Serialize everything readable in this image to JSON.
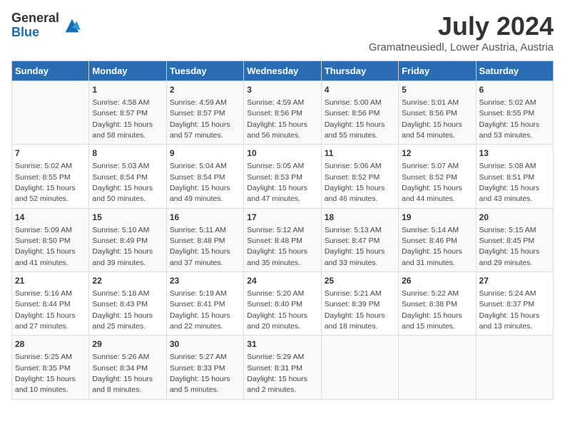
{
  "logo": {
    "general": "General",
    "blue": "Blue"
  },
  "title": "July 2024",
  "subtitle": "Gramatneusiedl, Lower Austria, Austria",
  "weekdays": [
    "Sunday",
    "Monday",
    "Tuesday",
    "Wednesday",
    "Thursday",
    "Friday",
    "Saturday"
  ],
  "weeks": [
    [
      {
        "day": null,
        "info": ""
      },
      {
        "day": "1",
        "info": "Sunrise: 4:58 AM\nSunset: 8:57 PM\nDaylight: 15 hours\nand 58 minutes."
      },
      {
        "day": "2",
        "info": "Sunrise: 4:59 AM\nSunset: 8:57 PM\nDaylight: 15 hours\nand 57 minutes."
      },
      {
        "day": "3",
        "info": "Sunrise: 4:59 AM\nSunset: 8:56 PM\nDaylight: 15 hours\nand 56 minutes."
      },
      {
        "day": "4",
        "info": "Sunrise: 5:00 AM\nSunset: 8:56 PM\nDaylight: 15 hours\nand 55 minutes."
      },
      {
        "day": "5",
        "info": "Sunrise: 5:01 AM\nSunset: 8:56 PM\nDaylight: 15 hours\nand 54 minutes."
      },
      {
        "day": "6",
        "info": "Sunrise: 5:02 AM\nSunset: 8:55 PM\nDaylight: 15 hours\nand 53 minutes."
      }
    ],
    [
      {
        "day": "7",
        "info": "Sunrise: 5:02 AM\nSunset: 8:55 PM\nDaylight: 15 hours\nand 52 minutes."
      },
      {
        "day": "8",
        "info": "Sunrise: 5:03 AM\nSunset: 8:54 PM\nDaylight: 15 hours\nand 50 minutes."
      },
      {
        "day": "9",
        "info": "Sunrise: 5:04 AM\nSunset: 8:54 PM\nDaylight: 15 hours\nand 49 minutes."
      },
      {
        "day": "10",
        "info": "Sunrise: 5:05 AM\nSunset: 8:53 PM\nDaylight: 15 hours\nand 47 minutes."
      },
      {
        "day": "11",
        "info": "Sunrise: 5:06 AM\nSunset: 8:52 PM\nDaylight: 15 hours\nand 46 minutes."
      },
      {
        "day": "12",
        "info": "Sunrise: 5:07 AM\nSunset: 8:52 PM\nDaylight: 15 hours\nand 44 minutes."
      },
      {
        "day": "13",
        "info": "Sunrise: 5:08 AM\nSunset: 8:51 PM\nDaylight: 15 hours\nand 43 minutes."
      }
    ],
    [
      {
        "day": "14",
        "info": "Sunrise: 5:09 AM\nSunset: 8:50 PM\nDaylight: 15 hours\nand 41 minutes."
      },
      {
        "day": "15",
        "info": "Sunrise: 5:10 AM\nSunset: 8:49 PM\nDaylight: 15 hours\nand 39 minutes."
      },
      {
        "day": "16",
        "info": "Sunrise: 5:11 AM\nSunset: 8:48 PM\nDaylight: 15 hours\nand 37 minutes."
      },
      {
        "day": "17",
        "info": "Sunrise: 5:12 AM\nSunset: 8:48 PM\nDaylight: 15 hours\nand 35 minutes."
      },
      {
        "day": "18",
        "info": "Sunrise: 5:13 AM\nSunset: 8:47 PM\nDaylight: 15 hours\nand 33 minutes."
      },
      {
        "day": "19",
        "info": "Sunrise: 5:14 AM\nSunset: 8:46 PM\nDaylight: 15 hours\nand 31 minutes."
      },
      {
        "day": "20",
        "info": "Sunrise: 5:15 AM\nSunset: 8:45 PM\nDaylight: 15 hours\nand 29 minutes."
      }
    ],
    [
      {
        "day": "21",
        "info": "Sunrise: 5:16 AM\nSunset: 8:44 PM\nDaylight: 15 hours\nand 27 minutes."
      },
      {
        "day": "22",
        "info": "Sunrise: 5:18 AM\nSunset: 8:43 PM\nDaylight: 15 hours\nand 25 minutes."
      },
      {
        "day": "23",
        "info": "Sunrise: 5:19 AM\nSunset: 8:41 PM\nDaylight: 15 hours\nand 22 minutes."
      },
      {
        "day": "24",
        "info": "Sunrise: 5:20 AM\nSunset: 8:40 PM\nDaylight: 15 hours\nand 20 minutes."
      },
      {
        "day": "25",
        "info": "Sunrise: 5:21 AM\nSunset: 8:39 PM\nDaylight: 15 hours\nand 18 minutes."
      },
      {
        "day": "26",
        "info": "Sunrise: 5:22 AM\nSunset: 8:38 PM\nDaylight: 15 hours\nand 15 minutes."
      },
      {
        "day": "27",
        "info": "Sunrise: 5:24 AM\nSunset: 8:37 PM\nDaylight: 15 hours\nand 13 minutes."
      }
    ],
    [
      {
        "day": "28",
        "info": "Sunrise: 5:25 AM\nSunset: 8:35 PM\nDaylight: 15 hours\nand 10 minutes."
      },
      {
        "day": "29",
        "info": "Sunrise: 5:26 AM\nSunset: 8:34 PM\nDaylight: 15 hours\nand 8 minutes."
      },
      {
        "day": "30",
        "info": "Sunrise: 5:27 AM\nSunset: 8:33 PM\nDaylight: 15 hours\nand 5 minutes."
      },
      {
        "day": "31",
        "info": "Sunrise: 5:29 AM\nSunset: 8:31 PM\nDaylight: 15 hours\nand 2 minutes."
      },
      {
        "day": null,
        "info": ""
      },
      {
        "day": null,
        "info": ""
      },
      {
        "day": null,
        "info": ""
      }
    ]
  ]
}
